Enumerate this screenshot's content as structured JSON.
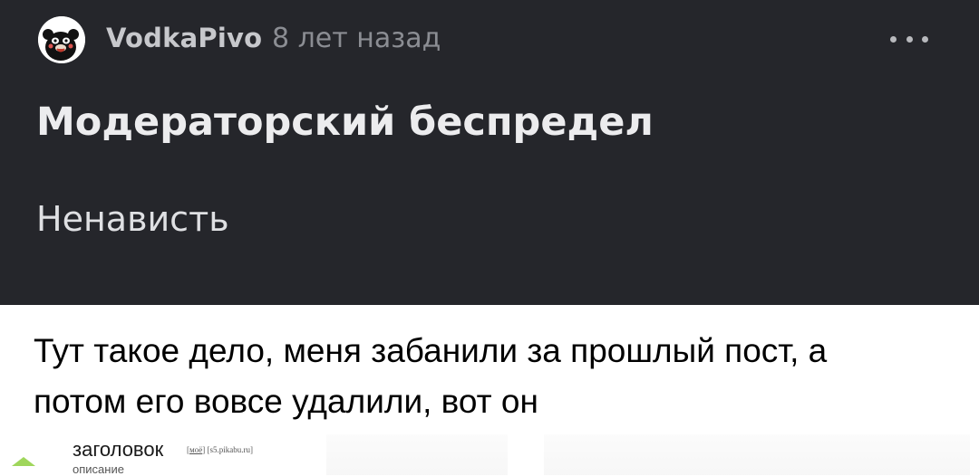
{
  "post": {
    "author": "VodkaPivo",
    "time_ago": "8 лет назад",
    "title": "Модераторский беспредел",
    "tag": "Ненависть",
    "body_line1": "Тут такое дело, меня забанили за прошлый пост, а",
    "body_line2": "потом его вовсе удалили, вот он"
  },
  "embedded": {
    "title": "заголовок",
    "my_label": "моё",
    "domain": "s5.pikabu.ru",
    "description": "описание"
  },
  "icons": {
    "avatar": "avatar-icon",
    "more": "more-dots-icon",
    "upvote": "upvote-arrow-icon"
  },
  "colors": {
    "header_bg": "#25262b",
    "content_bg": "#ffffff",
    "upvote": "#9fd65b"
  }
}
